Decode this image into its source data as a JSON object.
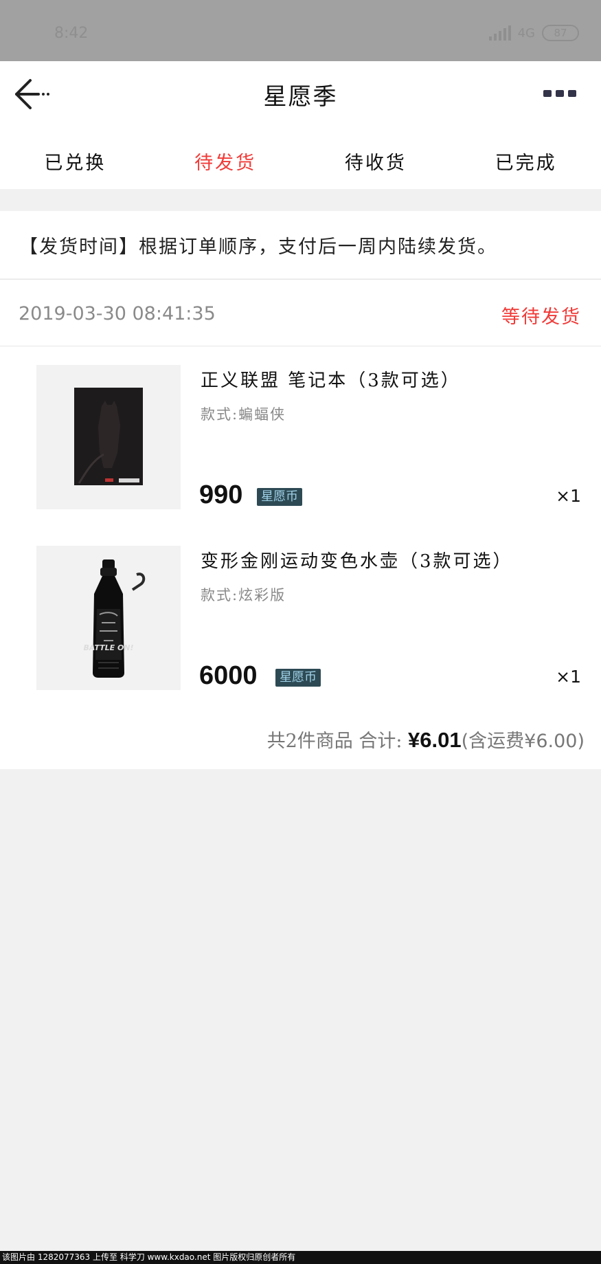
{
  "status_bar": {
    "time": "8:42",
    "network": "4G",
    "hd": "HD",
    "battery": "87"
  },
  "header": {
    "title": "星愿季",
    "back_icon": "back-arrow-icon",
    "more_icon": "more-dots-icon"
  },
  "tabs": [
    {
      "label": "已兑换",
      "active": false
    },
    {
      "label": "待发货",
      "active": true
    },
    {
      "label": "待收货",
      "active": false
    },
    {
      "label": "已完成",
      "active": false
    }
  ],
  "notice": {
    "text": "【发货时间】根据订单顺序，支付后一周内陆续发货。"
  },
  "order": {
    "time": "2019-03-30 08:41:35",
    "status": "等待发货",
    "items": [
      {
        "name": "正义联盟 笔记本（3款可选）",
        "style": "款式:蝙蝠侠",
        "price": "990",
        "currency": "星愿币",
        "qty": "×1"
      },
      {
        "name": "变形金刚运动变色水壶（3款可选）",
        "style": "款式:炫彩版",
        "price": "6000",
        "currency": "星愿币",
        "qty": "×1"
      }
    ],
    "summary": {
      "count_label": "共2件商品 合计:",
      "total": "¥6.01",
      "shipping": "(含运费¥6.00)"
    }
  },
  "watermark": "该图片由 1282077363 上传至 科学刀 www.kxdao.net 图片版权归原创者所有",
  "colors": {
    "accent": "#f03a37",
    "badge_bg": "#2d4a54",
    "badge_text": "#9fd0e6",
    "page_bg": "#f1f1f1"
  }
}
